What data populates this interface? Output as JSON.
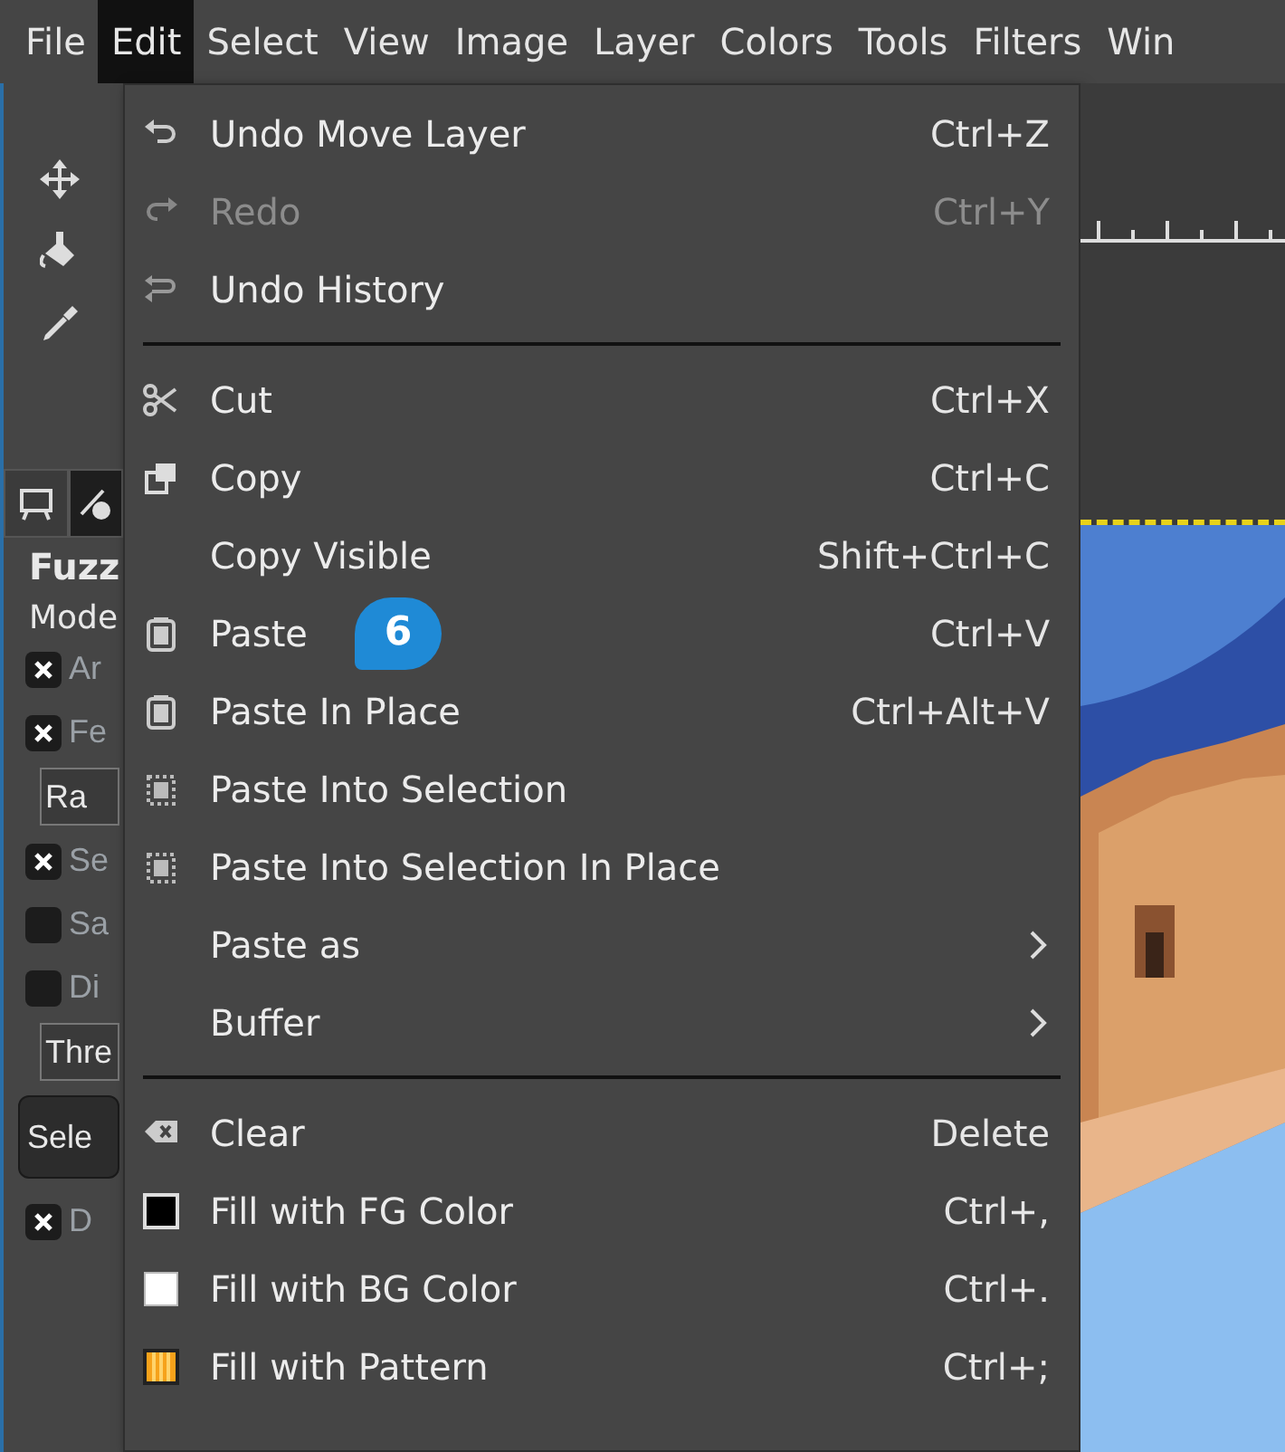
{
  "menubar": [
    {
      "label": "File",
      "selected": false
    },
    {
      "label": "Edit",
      "selected": true
    },
    {
      "label": "Select",
      "selected": false
    },
    {
      "label": "View",
      "selected": false
    },
    {
      "label": "Image",
      "selected": false
    },
    {
      "label": "Layer",
      "selected": false
    },
    {
      "label": "Colors",
      "selected": false
    },
    {
      "label": "Tools",
      "selected": false
    },
    {
      "label": "Filters",
      "selected": false
    },
    {
      "label": "Win",
      "selected": false
    }
  ],
  "tool_options": {
    "title": "Fuzz",
    "mode_label": "Mode",
    "options": [
      {
        "kind": "checkbox",
        "label": "Ar",
        "checked": true
      },
      {
        "kind": "checkbox",
        "label": "Fe",
        "checked": true
      },
      {
        "kind": "combo",
        "label": "Ra"
      },
      {
        "kind": "checkbox",
        "label": "Se",
        "checked": true
      },
      {
        "kind": "checkbox",
        "label": "Sa",
        "checked": false
      },
      {
        "kind": "checkbox",
        "label": "Di",
        "checked": false
      },
      {
        "kind": "combo",
        "label": "Thre"
      },
      {
        "kind": "button",
        "label": "Sele"
      },
      {
        "kind": "checkbox",
        "label": "D",
        "checked": true
      }
    ]
  },
  "edit_menu": [
    {
      "kind": "item",
      "label": "Undo Move Layer",
      "shortcut": "Ctrl+Z",
      "disabled": false
    },
    {
      "kind": "item",
      "label": "Redo",
      "shortcut": "Ctrl+Y",
      "disabled": true
    },
    {
      "kind": "item",
      "label": "Undo History",
      "disabled": false
    },
    {
      "kind": "separator"
    },
    {
      "kind": "item",
      "label": "Cut",
      "shortcut": "Ctrl+X",
      "disabled": false
    },
    {
      "kind": "item",
      "label": "Copy",
      "shortcut": "Ctrl+C",
      "disabled": false
    },
    {
      "kind": "item",
      "label": "Copy Visible",
      "shortcut": "Shift+Ctrl+C",
      "disabled": false
    },
    {
      "kind": "item",
      "label": "Paste",
      "shortcut": "Ctrl+V",
      "disabled": false,
      "callout": "6"
    },
    {
      "kind": "item",
      "label": "Paste In Place",
      "shortcut": "Ctrl+Alt+V",
      "disabled": false
    },
    {
      "kind": "item",
      "label": "Paste Into Selection",
      "disabled": false
    },
    {
      "kind": "item",
      "label": "Paste Into Selection In Place",
      "disabled": false
    },
    {
      "kind": "submenu",
      "label": "Paste as"
    },
    {
      "kind": "submenu",
      "label": "Buffer"
    },
    {
      "kind": "separator"
    },
    {
      "kind": "item",
      "label": "Clear",
      "shortcut": "Delete",
      "disabled": false
    },
    {
      "kind": "item",
      "label": "Fill with FG Color",
      "shortcut": "Ctrl+,",
      "disabled": false
    },
    {
      "kind": "item",
      "label": "Fill with BG Color",
      "shortcut": "Ctrl+.",
      "disabled": false
    },
    {
      "kind": "item",
      "label": "Fill with Pattern",
      "shortcut": "Ctrl+;",
      "disabled": false
    }
  ]
}
